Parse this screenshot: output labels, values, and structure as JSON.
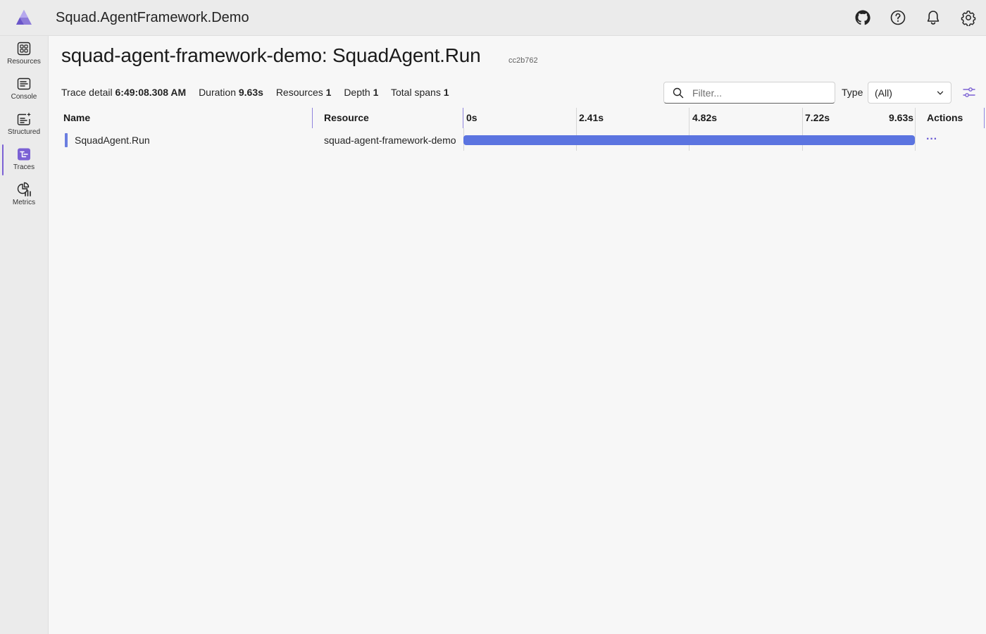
{
  "app": {
    "title": "Squad.AgentFramework.Demo"
  },
  "header_icons": [
    "github-icon",
    "help-icon",
    "notifications-icon",
    "settings-icon"
  ],
  "sidebar": {
    "items": [
      {
        "label": "Resources",
        "icon": "resources-icon",
        "active": false
      },
      {
        "label": "Console",
        "icon": "console-icon",
        "active": false
      },
      {
        "label": "Structured",
        "icon": "structured-logs-icon",
        "active": false
      },
      {
        "label": "Traces",
        "icon": "traces-icon",
        "active": true
      },
      {
        "label": "Metrics",
        "icon": "metrics-icon",
        "active": false
      }
    ]
  },
  "page": {
    "title": "squad-agent-framework-demo: SquadAgent.Run",
    "trace_id": "cc2b762"
  },
  "summary": {
    "trace_detail_label": "Trace detail",
    "trace_detail_value": "6:49:08.308 AM",
    "duration_label": "Duration",
    "duration_value": "9.63s",
    "resources_label": "Resources",
    "resources_value": "1",
    "depth_label": "Depth",
    "depth_value": "1",
    "total_spans_label": "Total spans",
    "total_spans_value": "1"
  },
  "filter": {
    "placeholder": "Filter..."
  },
  "type_filter": {
    "label": "Type",
    "selected": "(All)"
  },
  "columns": {
    "name": "Name",
    "resource": "Resource",
    "actions": "Actions"
  },
  "timeline_ticks": [
    "0s",
    "2.41s",
    "4.82s",
    "7.22s",
    "9.63s"
  ],
  "spans": [
    {
      "name": "SquadAgent.Run",
      "resource": "squad-agent-framework-demo",
      "start_fraction": 0,
      "duration_fraction": 1,
      "actions_label": "···"
    }
  ],
  "colors": {
    "accent": "#7b61d4",
    "span_bar": "#5b74e0"
  }
}
